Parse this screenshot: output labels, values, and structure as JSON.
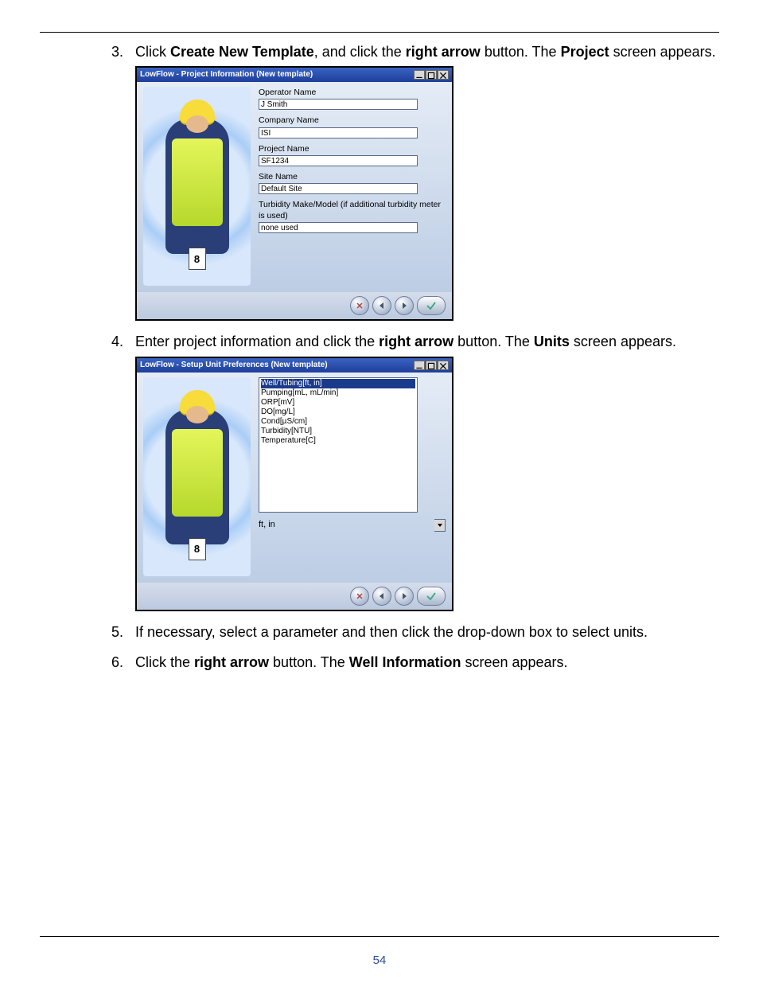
{
  "page_number": "54",
  "steps": {
    "s3": {
      "num": "3.",
      "pre": "Click ",
      "b1": "Create New Template",
      "mid1": ", and click the ",
      "b2": "right arrow",
      "mid2": " button. The ",
      "b3": "Project",
      "post": " screen appears."
    },
    "s4": {
      "num": "4.",
      "pre": "Enter project information and click the ",
      "b1": "right arrow",
      "mid1": " button. The ",
      "b2": "Units",
      "post": " screen appears."
    },
    "s5": {
      "num": "5.",
      "text": "If necessary, select a parameter and then click the drop-down box to select units."
    },
    "s6": {
      "num": "6.",
      "pre": "Click the ",
      "b1": "right arrow",
      "mid1": " button. The ",
      "b2": "Well Information",
      "post": " screen appears."
    }
  },
  "win1": {
    "title": "LowFlow - Project Information (New template)",
    "badge": "8",
    "fields": {
      "op": {
        "label": "Operator Name",
        "val": "J Smith"
      },
      "co": {
        "label": "Company Name",
        "val": "ISI"
      },
      "pr": {
        "label": "Project Name",
        "val": "SF1234"
      },
      "st": {
        "label": "Site Name",
        "val": "Default Site"
      },
      "tb": {
        "label": "Turbidity Make/Model (if additional turbidity meter is used)",
        "val": "none used"
      }
    }
  },
  "win2": {
    "title": "LowFlow - Setup Unit Preferences (New template)",
    "badge": "8",
    "list": {
      "i0": "Well/Tubing[ft, in]",
      "i1": "Pumping[mL, mL/min]",
      "i2": "ORP[mV]",
      "i3": "DO[mg/L]",
      "i4": "Cond[µS/cm]",
      "i5": "Turbidity[NTU]",
      "i6": "Temperature[C]"
    },
    "select_val": "ft, in"
  }
}
